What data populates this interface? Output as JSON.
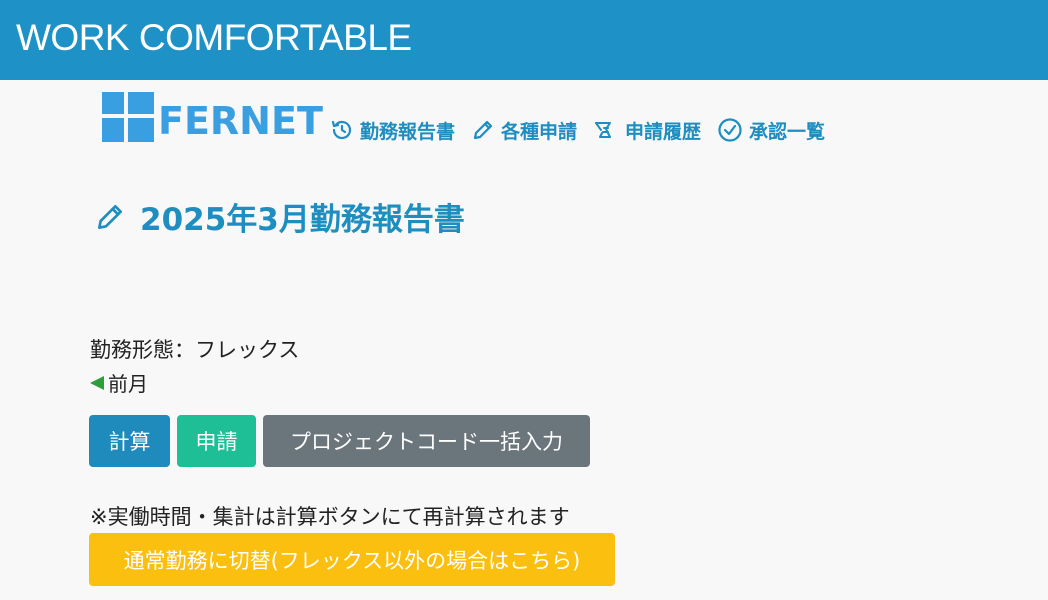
{
  "header": {
    "title": "WORK COMFORTABLE"
  },
  "logo": {
    "text": "FERNET",
    "color": "#3a9fe0"
  },
  "nav": {
    "items": [
      {
        "label": "勤務報告書",
        "icon": "history-icon"
      },
      {
        "label": "各種申請",
        "icon": "pencil-icon"
      },
      {
        "label": "申請履歴",
        "icon": "document-history-icon"
      },
      {
        "label": "承認一覧",
        "icon": "check-circle-icon"
      }
    ]
  },
  "page": {
    "title": "2025年3月勤務報告書",
    "work_type": "勤務形態：フレックス",
    "prev_month": "前月",
    "note": "※実働時間・集計は計算ボタンにて再計算されます"
  },
  "buttons": {
    "calc": "計算",
    "apply": "申請",
    "project_code": "プロジェクトコード一括入力",
    "switch_mode": "通常勤務に切替(フレックス以外の場合はこちら)"
  },
  "colors": {
    "header_bg": "#1e92c6",
    "accent": "#1e8ec0",
    "calc": "#1f8bbd",
    "apply": "#1ebf96",
    "project": "#6b757c",
    "switch": "#fbbf0f",
    "prev_arrow": "#2e9e3a"
  }
}
